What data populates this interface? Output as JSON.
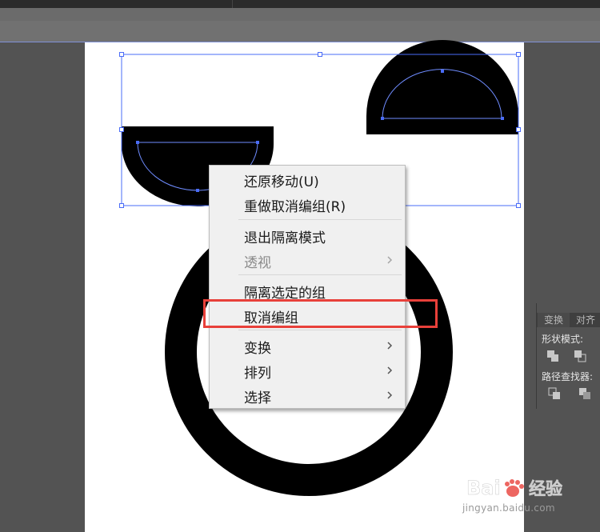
{
  "context_menu": {
    "items": [
      {
        "label": "还原移动(U)"
      },
      {
        "label": "重做取消编组(R)"
      },
      {
        "label": "退出隔离模式"
      },
      {
        "label": "透视"
      },
      {
        "label": "隔离选定的组"
      },
      {
        "label": "取消编组"
      },
      {
        "label": "变换"
      },
      {
        "label": "排列"
      },
      {
        "label": "选择"
      }
    ]
  },
  "panel": {
    "tabs": [
      "变换",
      "对齐"
    ],
    "shape_modes_label": "形状模式:",
    "pathfinder_label": "路径查找器:"
  },
  "watermark": {
    "brand": "Bai du 经验",
    "url": "jingyan.baidu.com"
  },
  "colors": {
    "highlight": "#e8403a",
    "selection": "#4a6cf7"
  }
}
